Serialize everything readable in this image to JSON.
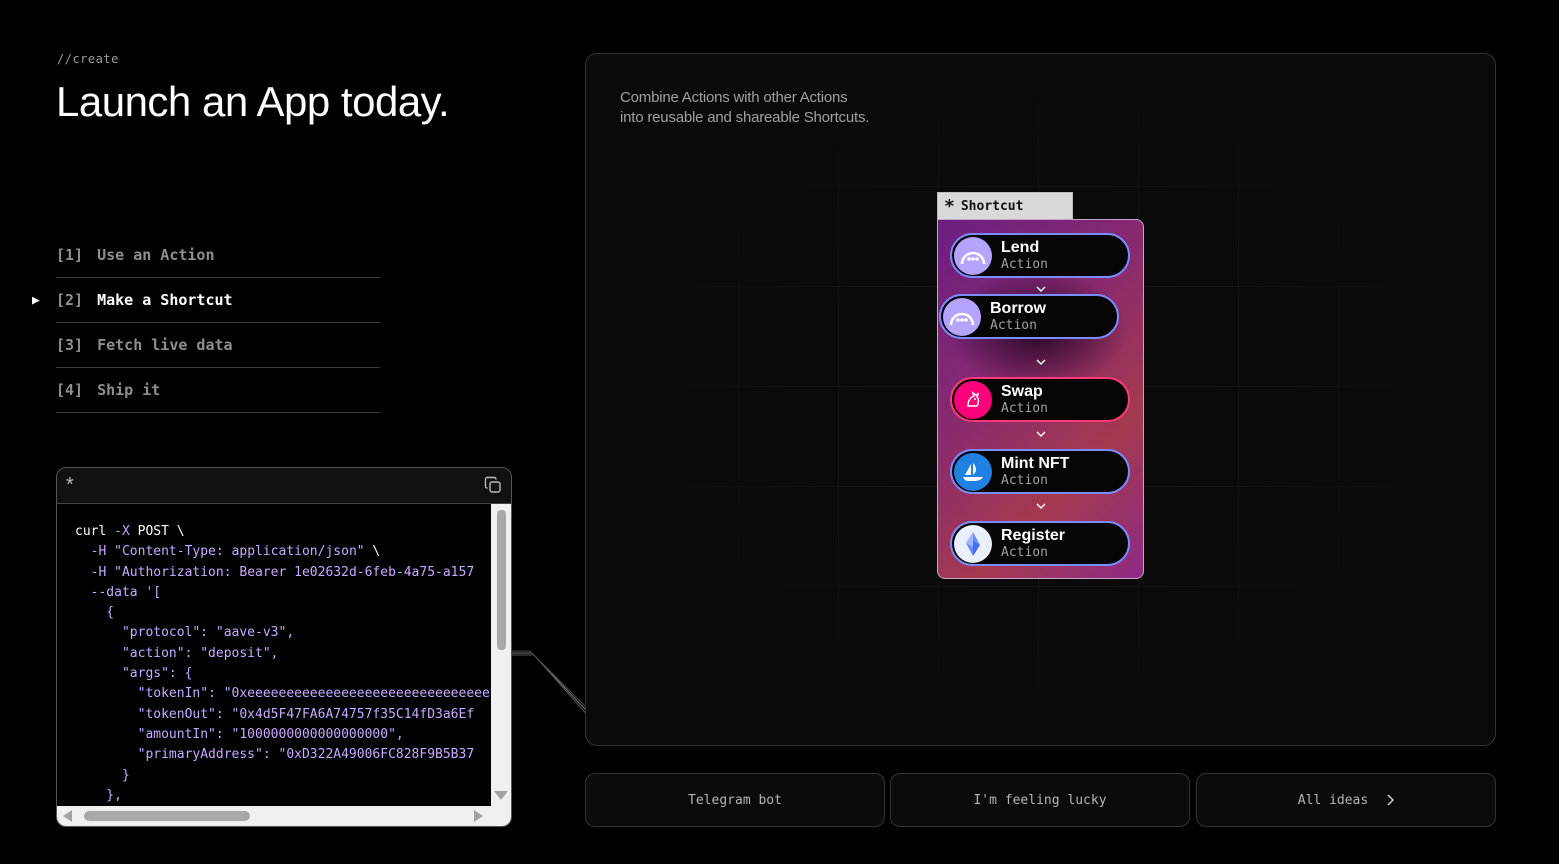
{
  "header": {
    "eyebrow": "//create",
    "title": "Launch an App today."
  },
  "steps": [
    {
      "num": "[1]",
      "label": "Use an Action",
      "active": false
    },
    {
      "num": "[2]",
      "label": "Make a Shortcut",
      "active": true
    },
    {
      "num": "[3]",
      "label": "Fetch live data",
      "active": false
    },
    {
      "num": "[4]",
      "label": "Ship it",
      "active": false
    }
  ],
  "code": {
    "lines": [
      [
        [
          "curl ",
          "w"
        ],
        [
          "-X",
          "p"
        ],
        [
          " POST \\",
          "w"
        ]
      ],
      [
        [
          "  -H ",
          "p"
        ],
        [
          "\"Content-Type: application/json\"",
          "p"
        ],
        [
          " \\",
          "w"
        ]
      ],
      [
        [
          "  -H ",
          "p"
        ],
        [
          "\"Authorization: Bearer 1e02632d-6feb-4a75-a157",
          "p"
        ]
      ],
      [
        [
          "  --data ",
          "p"
        ],
        [
          "'[",
          "p"
        ]
      ],
      [
        [
          "    {",
          "p"
        ]
      ],
      [
        [
          "      \"protocol\": \"aave-v3\",",
          "p"
        ]
      ],
      [
        [
          "      \"action\": \"deposit\",",
          "p"
        ]
      ],
      [
        [
          "      \"args\": {",
          "p"
        ]
      ],
      [
        [
          "        \"tokenIn\": \"0xeeeeeeeeeeeeeeeeeeeeeeeeeeeeeee",
          "p"
        ]
      ],
      [
        [
          "        \"tokenOut\": \"0x4d5F47FA6A74757f35C14fD3a6Ef",
          "p"
        ]
      ],
      [
        [
          "        \"amountIn\": \"1000000000000000000\",",
          "p"
        ]
      ],
      [
        [
          "        \"primaryAddress\": \"0xD322A49006FC828F9B5B37",
          "p"
        ]
      ],
      [
        [
          "      }",
          "p"
        ]
      ],
      [
        [
          "    },",
          "p"
        ]
      ]
    ]
  },
  "canvas": {
    "caption_line1": "Combine Actions with other Actions",
    "caption_line2": "into reusable and shareable Shortcuts.",
    "shortcut_label": "Shortcut",
    "actions": [
      {
        "name": "Lend",
        "sub": "Action",
        "icon": "aave-ghost-icon"
      },
      {
        "name": "Borrow",
        "sub": "Action",
        "icon": "aave-ghost-icon"
      },
      {
        "name": "Swap",
        "sub": "Action",
        "icon": "uniswap-unicorn-icon"
      },
      {
        "name": "Mint NFT",
        "sub": "Action",
        "icon": "opensea-boat-icon"
      },
      {
        "name": "Register",
        "sub": "Action",
        "icon": "ens-icon"
      }
    ]
  },
  "buttons": {
    "telegram": "Telegram bot",
    "lucky": "I'm feeling lucky",
    "ideas": "All ideas"
  },
  "colors": {
    "accent_purple": "#c9a9ff",
    "pill_border": "#7b8cff",
    "swap_pink": "#ff3a7a",
    "aave_icon": "#b6a3ff",
    "opensea_blue": "#2081e2"
  }
}
